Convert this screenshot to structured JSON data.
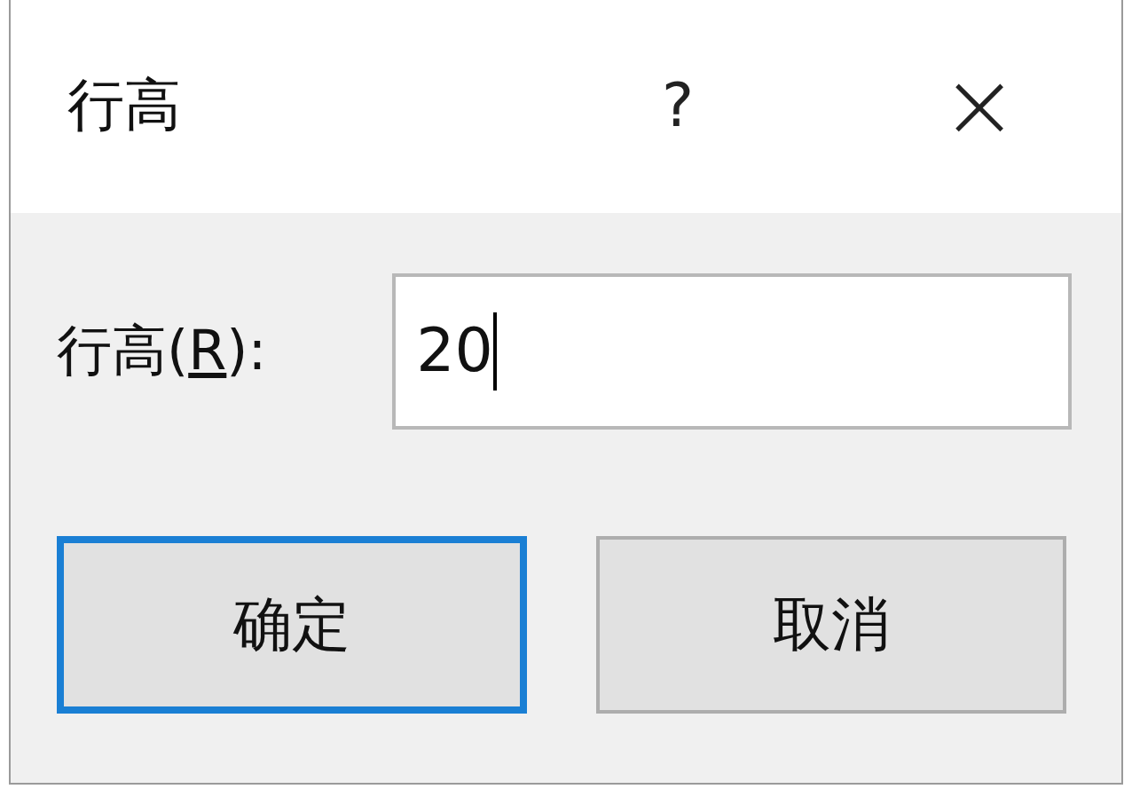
{
  "window": {
    "title": "行高",
    "help": "?",
    "close": "×"
  },
  "field": {
    "label": "行高(R):",
    "value": "20",
    "focused": true
  },
  "buttons": [
    {
      "label": "确定",
      "default": true
    },
    {
      "label": "取消",
      "default": false
    }
  ]
}
